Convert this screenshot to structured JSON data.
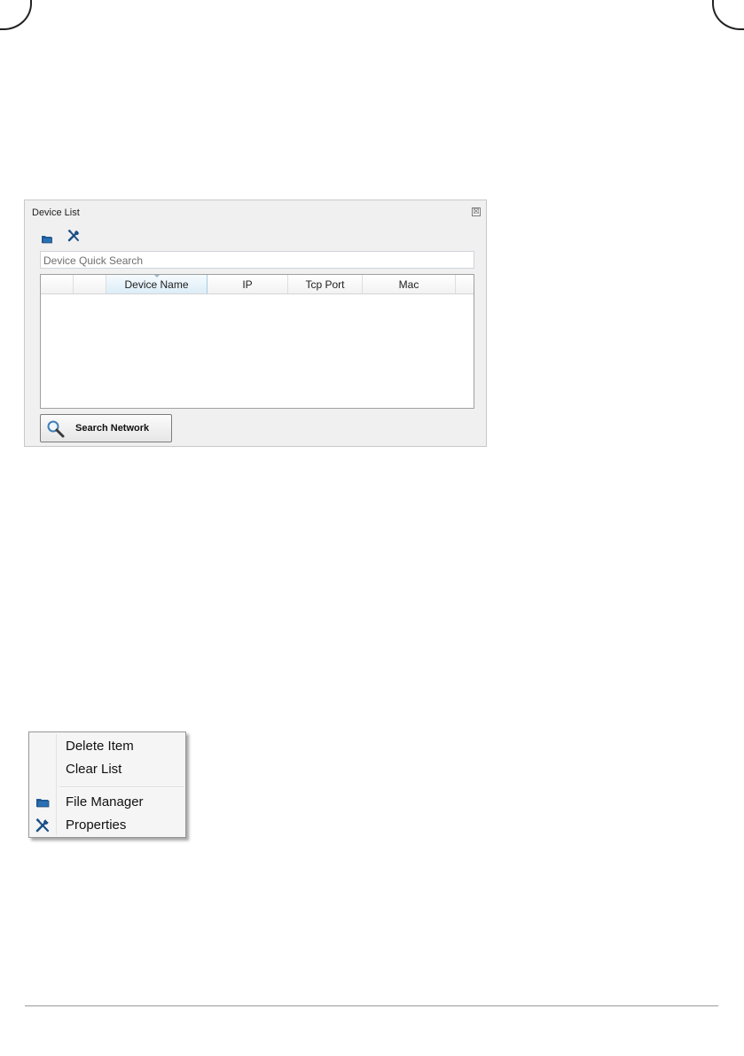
{
  "device_list": {
    "title": "Device List",
    "close_glyph": "☒",
    "toolbar": {
      "file_manager_icon": "folder-icon",
      "properties_icon": "tools-icon"
    },
    "search": {
      "placeholder": "Device Quick Search",
      "value": ""
    },
    "columns": [
      "",
      "",
      "Device Name",
      "IP",
      "Tcp Port",
      "Mac",
      ""
    ],
    "sorted_column": "Device Name",
    "rows": [],
    "search_button": {
      "label": "Search Network",
      "icon": "magnifier-icon"
    }
  },
  "context_menu": {
    "items": [
      {
        "label": "Delete Item",
        "icon": ""
      },
      {
        "label": "Clear List",
        "icon": ""
      },
      {
        "label": "File Manager",
        "icon": "folder-icon"
      },
      {
        "label": "Properties",
        "icon": "tools-icon"
      }
    ]
  },
  "colors": {
    "panel_bg": "#f0f0f0",
    "icon_blue": "#1f5fa0",
    "sorted_header": "#dcedf7"
  }
}
